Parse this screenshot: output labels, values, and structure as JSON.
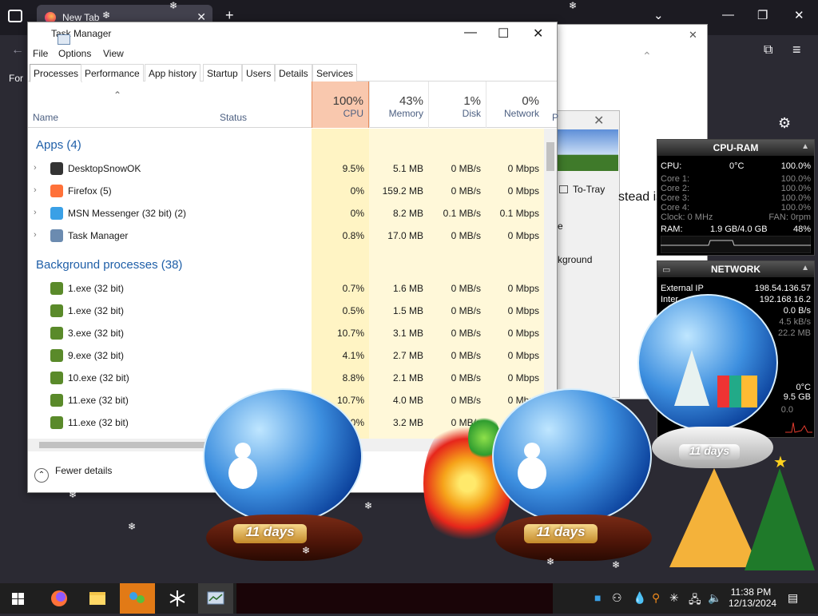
{
  "firefox": {
    "tab_title": "New Tab",
    "bookmark_text": "For"
  },
  "dialog": {
    "to_tray": "To-Tray",
    "instead_text": "stead is",
    "partial_e": "e",
    "partial_bg": "kground"
  },
  "taskmanager": {
    "title": "Task Manager",
    "menu": [
      "File",
      "Options",
      "View"
    ],
    "tabs": [
      "Processes",
      "Performance",
      "App history",
      "Startup",
      "Users",
      "Details",
      "Services"
    ],
    "columns": {
      "name": "Name",
      "status": "Status",
      "cpu_pct": "100%",
      "cpu": "CPU",
      "mem_pct": "43%",
      "mem": "Memory",
      "disk_pct": "1%",
      "disk": "Disk",
      "net_pct": "0%",
      "net": "Network",
      "p": "P"
    },
    "apps_group": "Apps (4)",
    "bg_group": "Background processes (38)",
    "apps": [
      {
        "name": "DesktopSnowOK",
        "cpu": "9.5%",
        "mem": "5.1 MB",
        "disk": "0 MB/s",
        "net": "0 Mbps"
      },
      {
        "name": "Firefox (5)",
        "cpu": "0%",
        "mem": "159.2 MB",
        "disk": "0 MB/s",
        "net": "0 Mbps"
      },
      {
        "name": "MSN Messenger (32 bit) (2)",
        "cpu": "0%",
        "mem": "8.2 MB",
        "disk": "0.1 MB/s",
        "net": "0.1 Mbps"
      },
      {
        "name": "Task Manager",
        "cpu": "0.8%",
        "mem": "17.0 MB",
        "disk": "0 MB/s",
        "net": "0 Mbps"
      }
    ],
    "background": [
      {
        "name": "1.exe (32 bit)",
        "cpu": "0.7%",
        "mem": "1.6 MB",
        "disk": "0 MB/s",
        "net": "0 Mbps"
      },
      {
        "name": "1.exe (32 bit)",
        "cpu": "0.5%",
        "mem": "1.5 MB",
        "disk": "0 MB/s",
        "net": "0 Mbps"
      },
      {
        "name": "3.exe (32 bit)",
        "cpu": "10.7%",
        "mem": "3.1 MB",
        "disk": "0 MB/s",
        "net": "0 Mbps"
      },
      {
        "name": "9.exe (32 bit)",
        "cpu": "4.1%",
        "mem": "2.7 MB",
        "disk": "0 MB/s",
        "net": "0 Mbps"
      },
      {
        "name": "10.exe (32 bit)",
        "cpu": "8.8%",
        "mem": "2.1 MB",
        "disk": "0 MB/s",
        "net": "0 Mbps"
      },
      {
        "name": "11.exe (32 bit)",
        "cpu": "10.7%",
        "mem": "4.0 MB",
        "disk": "0 MB/s",
        "net": "0 Mbps"
      },
      {
        "name": "11.exe (32 bit)",
        "cpu": "0%",
        "mem": "3.2 MB",
        "disk": "0 MB/s",
        "net": "0 Mbps"
      }
    ],
    "fewer_details": "Fewer details"
  },
  "cpu_gadget": {
    "title": "CPU-RAM",
    "cpu_label": "CPU:",
    "cpu_temp": "0°C",
    "cpu_value": "100.0%",
    "cores": [
      {
        "label": "Core 1:",
        "value": "100.0%"
      },
      {
        "label": "Core 2:",
        "value": "100.0%"
      },
      {
        "label": "Core 3:",
        "value": "100.0%"
      },
      {
        "label": "Core 4:",
        "value": "100.0%"
      }
    ],
    "clock": "Clock: 0 MHz",
    "fan": "FAN: 0rpm",
    "ram_label": "RAM:",
    "ram_value": "1.9 GB/4.0 GB",
    "ram_pct": "48%"
  },
  "net_gadget": {
    "title": "NETWORK",
    "external_label": "External IP",
    "external_value": "198.54.136.57",
    "internal_label": "Inter",
    "internal_value": "192.168.16.2",
    "down": "0.0 B/s",
    "up": "4.5 kB/s",
    "total": "22.2 MB",
    "temp": "0°C",
    "size": "9.5 GB",
    "zero": "0.0"
  },
  "globes": {
    "days_label": "11 days"
  },
  "taskbar": {
    "time": "11:38 PM",
    "date": "12/13/2024"
  }
}
